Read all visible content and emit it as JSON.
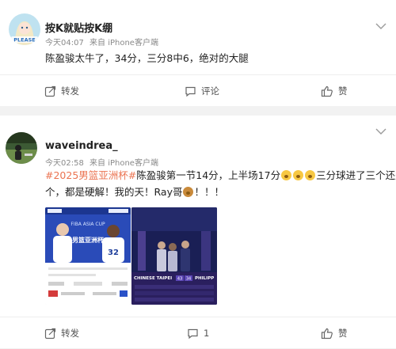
{
  "posts": [
    {
      "username": "按K就贴按K绷",
      "time": "今天04:07",
      "source": "来自 iPhone客户端",
      "text": "陈盈骏太牛了，34分，三分8中6，绝对的大腿",
      "avatar_text": "PLEASE",
      "actions": {
        "repost": "转发",
        "comment": "评论",
        "like": "赞"
      }
    },
    {
      "username": "waveindrea_",
      "time": "今天02:58",
      "source": "来自 iPhone客户端",
      "hashtag": "#2025男篮亚洲杯#",
      "text_part1": "陈盈骏第一节14分，上半场17分",
      "text_part2": "三分球进了三个还是四",
      "text_line2": "个，都是硬解！我的天！Ray哥",
      "text_tail": "！！！",
      "actions": {
        "repost": "转发",
        "comment": "1",
        "like": "赞"
      },
      "images": [
        {
          "headline": "男篮亚洲杯",
          "badge": "FIBA ASIA CUP",
          "jersey": "32"
        },
        {
          "team_left": "CHINESE TAIPEI",
          "score_left": "43",
          "score_right": "34",
          "team_right": "PHILIPP"
        }
      ]
    }
  ],
  "colors": {
    "hashtag": "#eb7350",
    "meta_gray": "#8a8a8a",
    "divider": "#f2f2f2"
  }
}
